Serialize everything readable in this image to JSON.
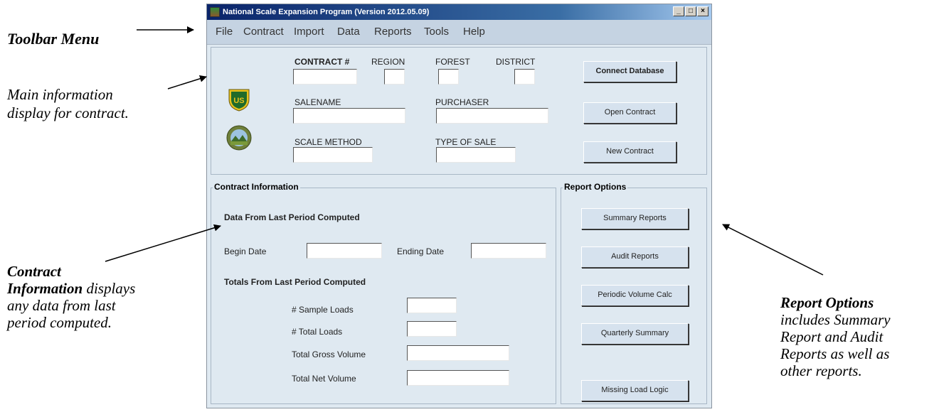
{
  "annotations": {
    "toolbar_menu": "Toolbar Menu",
    "main_info_1": "Main information",
    "main_info_2": "display for contract.",
    "contract_info_bold_1": "Contract",
    "contract_info_bold_2": "Information",
    "contract_info_rest_2": " displays",
    "contract_info_3": "any data from last",
    "contract_info_4": "period computed.",
    "report_opts_bold": "Report Options",
    "report_opts_2": "includes Summary",
    "report_opts_3": "Report and Audit",
    "report_opts_4": "Reports as well as",
    "report_opts_5": "other reports."
  },
  "window": {
    "title": "National Scale Expansion Program (Version 2012.05.09)",
    "controls": [
      "_",
      "□",
      "×"
    ]
  },
  "menu": [
    "File",
    "Contract",
    "Import",
    "Data",
    "Reports",
    "Tools",
    "Help"
  ],
  "header": {
    "contract_label": "CONTRACT #",
    "region_label": "REGION",
    "forest_label": "FOREST",
    "district_label": "DISTRICT",
    "salename_label": "SALENAME",
    "purchaser_label": "PURCHASER",
    "scale_method_label": "SCALE METHOD",
    "type_of_sale_label": "TYPE OF SALE",
    "fields": {
      "contract": "",
      "region": "",
      "forest": "",
      "district": "",
      "salename": "",
      "purchaser": "",
      "scale_method": "",
      "type_of_sale": ""
    },
    "buttons": {
      "connect": "Connect Database",
      "open": "Open Contract",
      "new": "New Contract"
    },
    "logos": {
      "usfs": "US",
      "seal": "seal-icon"
    }
  },
  "contract_info": {
    "title": "Contract Information",
    "data_heading": "Data From Last Period Computed",
    "begin_date_label": "Begin Date",
    "ending_date_label": "Ending Date",
    "totals_heading": "Totals From Last Period Computed",
    "sample_loads_label": "# Sample Loads",
    "total_loads_label": "# Total Loads",
    "gross_volume_label": "Total Gross Volume",
    "net_volume_label": "Total Net Volume",
    "values": {
      "begin_date": "",
      "ending_date": "",
      "sample_loads": "",
      "total_loads": "",
      "gross_volume": "",
      "net_volume": ""
    }
  },
  "report_options": {
    "title": "Report Options",
    "buttons": [
      "Summary Reports",
      "Audit Reports",
      "Periodic Volume Calc",
      "Quarterly Summary",
      "Missing Load Logic"
    ]
  },
  "colors": {
    "window_bg": "#dfe9f1",
    "menubar_bg": "#c5d3e2",
    "titlebar": "#0a246a",
    "usfs_green": "#1f6b2a",
    "usfs_gold": "#e8c21c"
  }
}
